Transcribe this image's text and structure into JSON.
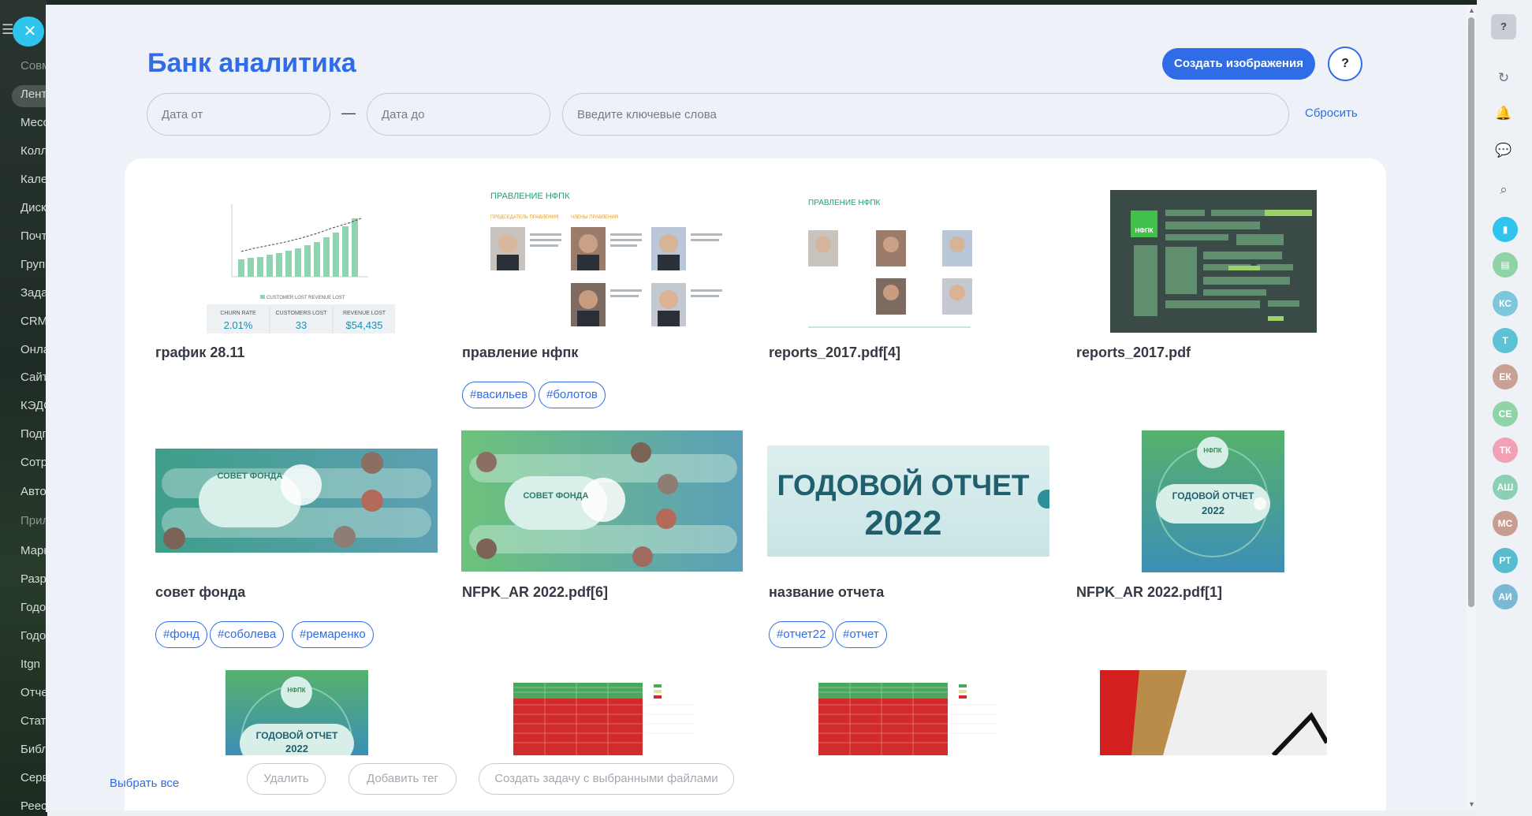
{
  "left_sidebar": {
    "items": [
      "Совм",
      "Лент",
      "Месс",
      "Колл",
      "Кале",
      "Диск",
      "Почт",
      "Груп",
      "Зада",
      "CRM",
      "Онла",
      "Сайт",
      "КЭДО",
      "Подп",
      "Сотр",
      "Авто",
      "Прил",
      "Марк",
      "Разр",
      "Годо",
      "Годо",
      "Itgn",
      "Отче",
      "Стат",
      "Библ",
      "Серв",
      "Реес"
    ]
  },
  "header": {
    "title": "Банк аналитика",
    "create_button": "Создать изображения",
    "help_button": "?"
  },
  "filters": {
    "date_from_placeholder": "Дата от",
    "date_separator": "—",
    "date_to_placeholder": "Дата до",
    "keywords_placeholder": "Введите ключевые слова",
    "reset_label": "Сбросить"
  },
  "gallery": {
    "items": [
      {
        "title": "график 28.11",
        "tags": [],
        "thumb_text": {
          "k1": "CHURN RATE",
          "v1": "2.01%",
          "k2": "CUSTOMERS LOST",
          "v2": "33",
          "k3": "REVENUE LOST",
          "v3": "$54,435",
          "legend": "CUSTOMER LOST  REVENUE LOST"
        }
      },
      {
        "title": "правление нфпк",
        "tags": [
          "#васильев",
          "#болотов"
        ],
        "thumb_text": {
          "heading": "ПРАВЛЕНИЕ НФПК",
          "left": "ПРЕДСЕДАТЕЛЬ ПРАВЛЕНИЯ",
          "right": "ЧЛЕНЫ ПРАВЛЕНИЯ"
        }
      },
      {
        "title": "reports_2017.pdf[4]",
        "tags": [],
        "thumb_text": {
          "heading": "ПРАВЛЕНИЕ НФПК"
        }
      },
      {
        "title": "reports_2017.pdf",
        "tags": [],
        "thumb_text": {
          "logo": "НФПК"
        }
      },
      {
        "title": "совет фонда",
        "tags": [
          "#фонд",
          "#соболева",
          "#ремаренко"
        ],
        "thumb_text": {
          "center": "СОВЕТ ФОНДА"
        }
      },
      {
        "title": "NFPK_AR 2022.pdf[6]",
        "tags": [],
        "thumb_text": {
          "center": "СОВЕТ ФОНДА"
        }
      },
      {
        "title": "название отчета",
        "tags": [
          "#отчет22",
          "#отчет"
        ],
        "thumb_text": {
          "line1": "ГОДОВОЙ ОТЧЕТ",
          "line2": "2022"
        }
      },
      {
        "title": "NFPK_AR 2022.pdf[1]",
        "tags": [],
        "thumb_text": {
          "logo": "НФПК",
          "line1": "ГОДОВОЙ ОТЧЕТ",
          "line2": "2022"
        }
      },
      {
        "title": "",
        "tags": [],
        "thumb_text": {
          "logo": "НФПК",
          "line1": "ГОДОВОЙ ОТЧЕТ",
          "line2": "2022"
        }
      },
      {
        "title": "",
        "tags": [],
        "thumb_text": {}
      },
      {
        "title": "",
        "tags": [],
        "thumb_text": {}
      },
      {
        "title": "",
        "tags": [],
        "thumb_text": {}
      }
    ]
  },
  "actions": {
    "select_all": "Выбрать все",
    "delete": "Удалить",
    "add_tag": "Добавить тег",
    "create_task": "Создать задачу с выбранными файлами"
  },
  "right_sidebar": {
    "avatars": [
      {
        "initials": "КС",
        "color": "#7cc7dc"
      },
      {
        "initials": "Т",
        "color": "#5ec2d6"
      },
      {
        "initials": "ЕК",
        "color": "#c8a094"
      },
      {
        "initials": "СЕ",
        "color": "#8fd3a6"
      },
      {
        "initials": "ТК",
        "color": "#f2a0b4"
      },
      {
        "initials": "АШ",
        "color": "#8ccfb5"
      },
      {
        "initials": "МС",
        "color": "#c79d92"
      },
      {
        "initials": "РТ",
        "color": "#56bcd0"
      },
      {
        "initials": "АИ",
        "color": "#7ab9d6"
      }
    ]
  }
}
